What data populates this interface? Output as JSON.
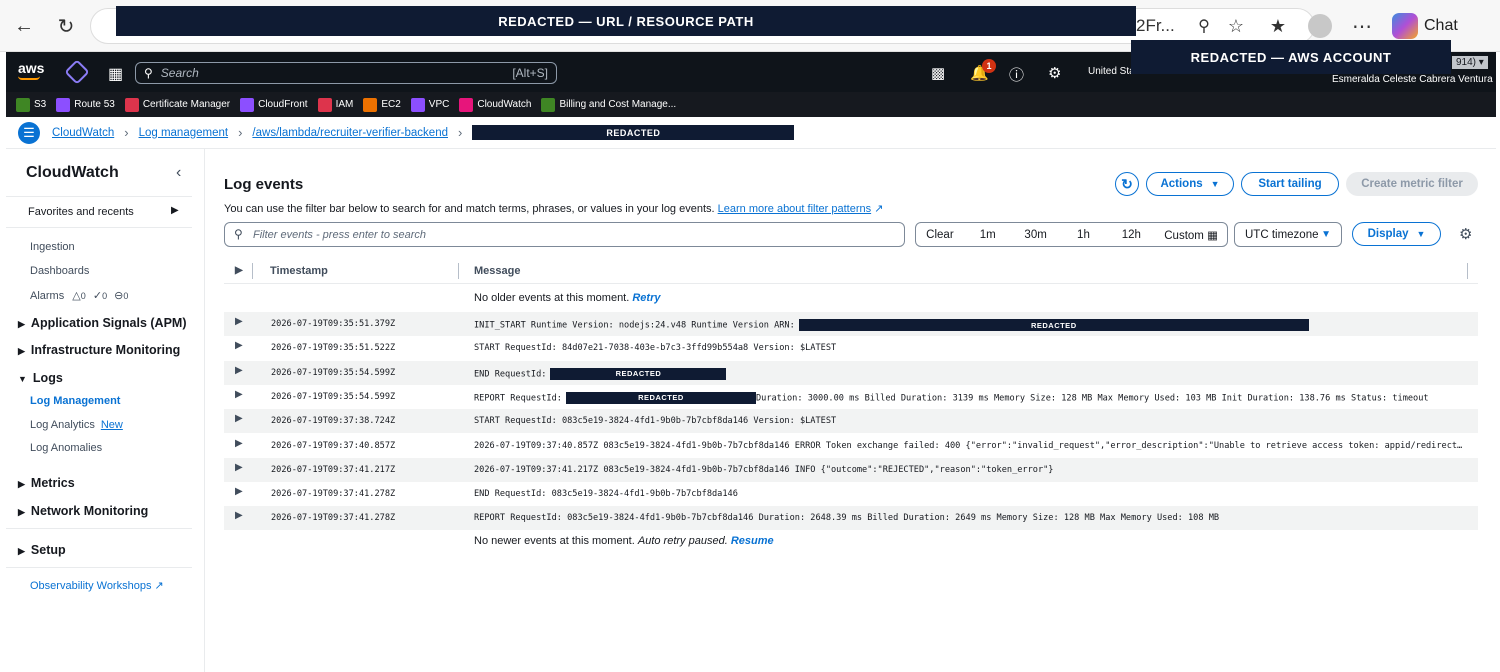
{
  "browser": {
    "url_redacted_label": "REDACTED — URL / RESOURCE PATH",
    "url_tail": "2Fr...",
    "chat_label": "Chat"
  },
  "aws_header": {
    "logo": "aws",
    "search_placeholder": "Search",
    "search_shortcut": "[Alt+S]",
    "notification_count": "1",
    "region": "United Sta",
    "account_redacted_label": "REDACTED — AWS ACCOUNT",
    "account_tail": "914) ▾",
    "username": "Esmeralda Celeste Cabrera Ventura"
  },
  "favorites": [
    {
      "label": "S3",
      "color": "#3f8624"
    },
    {
      "label": "Route 53",
      "color": "#8c4fff"
    },
    {
      "label": "Certificate Manager",
      "color": "#dd344c"
    },
    {
      "label": "CloudFront",
      "color": "#8c4fff"
    },
    {
      "label": "IAM",
      "color": "#dd344c"
    },
    {
      "label": "EC2",
      "color": "#ed7100"
    },
    {
      "label": "VPC",
      "color": "#8c4fff"
    },
    {
      "label": "CloudWatch",
      "color": "#e7157b"
    },
    {
      "label": "Billing and Cost Manage...",
      "color": "#3f8624"
    }
  ],
  "breadcrumb": {
    "items": [
      "CloudWatch",
      "Log management",
      "/aws/lambda/recruiter-verifier-backend"
    ],
    "redacted_label": "REDACTED"
  },
  "sidebar": {
    "title": "CloudWatch",
    "favorites": "Favorites and recents",
    "ingestion": "Ingestion",
    "dashboards": "Dashboards",
    "alarms": "Alarms",
    "alarm_counts": [
      "0",
      "0",
      "0"
    ],
    "app_signals": "Application Signals (APM)",
    "infra": "Infrastructure Monitoring",
    "logs": "Logs",
    "log_management": "Log Management",
    "log_analytics": "Log Analytics",
    "new_tag": "New",
    "log_anomalies": "Log Anomalies",
    "metrics": "Metrics",
    "network": "Network Monitoring",
    "setup": "Setup",
    "workshops": "Observability Workshops"
  },
  "main": {
    "title": "Log events",
    "description": "You can use the filter bar below to search for and match terms, phrases, or values in your log events.",
    "learn_more": "Learn more about filter patterns",
    "actions_label": "Actions",
    "start_tailing_label": "Start tailing",
    "create_metric_filter_label": "Create metric filter",
    "filter_placeholder": "Filter events - press enter to search",
    "time_ranges": [
      "Clear",
      "1m",
      "30m",
      "1h",
      "12h"
    ],
    "custom_label": "Custom",
    "timezone": "UTC timezone",
    "display_label": "Display",
    "columns": [
      "Timestamp",
      "Message"
    ],
    "no_older": "No older events at this moment.",
    "retry": "Retry",
    "no_newer": "No newer events at this moment.",
    "auto_retry": "Auto retry paused.",
    "resume": "Resume"
  },
  "log_rows": [
    {
      "timestamp": "2026-07-19T09:35:51.379Z",
      "message_pre": "INIT_START Runtime Version: nodejs:24.v48 Runtime Version ARN:",
      "redacted": "REDACTED",
      "message_post": ""
    },
    {
      "timestamp": "2026-07-19T09:35:51.522Z",
      "message_pre": "START RequestId: 84d07e21-7038-403e-b7c3-3ffd99b554a8 Version: $LATEST",
      "redacted": "",
      "message_post": ""
    },
    {
      "timestamp": "2026-07-19T09:35:54.599Z",
      "message_pre": "END RequestId:",
      "redacted": "REDACTED",
      "message_post": ""
    },
    {
      "timestamp": "2026-07-19T09:35:54.599Z",
      "message_pre": "REPORT RequestId:",
      "redacted": "REDACTED",
      "message_post": "Duration: 3000.00 ms Billed Duration: 3139 ms Memory Size: 128 MB Max Memory Used: 103 MB Init Duration: 138.76 ms Status: timeout"
    },
    {
      "timestamp": "2026-07-19T09:37:38.724Z",
      "message_pre": "START RequestId: 083c5e19-3824-4fd1-9b0b-7b7cbf8da146 Version: $LATEST",
      "redacted": "",
      "message_post": ""
    },
    {
      "timestamp": "2026-07-19T09:37:40.857Z",
      "message_pre": "2026-07-19T09:37:40.857Z 083c5e19-3824-4fd1-9b0b-7b7cbf8da146 ERROR Token exchange failed: 400 {\"error\":\"invalid_request\",\"error_description\":\"Unable to retrieve access token: appid/redirect...",
      "redacted": "",
      "message_post": ""
    },
    {
      "timestamp": "2026-07-19T09:37:41.217Z",
      "message_pre": "2026-07-19T09:37:41.217Z 083c5e19-3824-4fd1-9b0b-7b7cbf8da146 INFO {\"outcome\":\"REJECTED\",\"reason\":\"token_error\"}",
      "redacted": "",
      "message_post": ""
    },
    {
      "timestamp": "2026-07-19T09:37:41.278Z",
      "message_pre": "END RequestId: 083c5e19-3824-4fd1-9b0b-7b7cbf8da146",
      "redacted": "",
      "message_post": ""
    },
    {
      "timestamp": "2026-07-19T09:37:41.278Z",
      "message_pre": "REPORT RequestId: 083c5e19-3824-4fd1-9b0b-7b7cbf8da146 Duration: 2648.39 ms Billed Duration: 2649 ms Memory Size: 128 MB Max Memory Used: 108 MB",
      "redacted": "",
      "message_post": ""
    }
  ]
}
